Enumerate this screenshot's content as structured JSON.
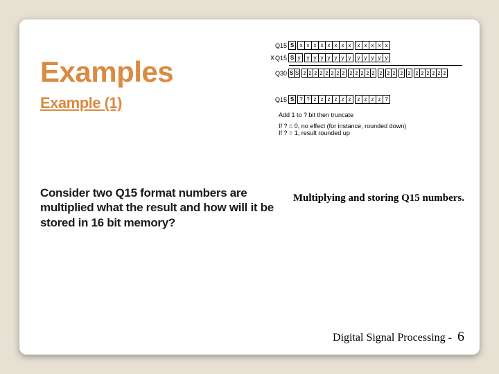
{
  "title": "Examples",
  "subtitle": "Example (1)",
  "body": "Consider two Q15 format numbers are multiplied what the result and how will it be stored in 16 bit memory?",
  "caption": "Multiplying and storing Q15 numbers.",
  "footer_text": "Digital Signal Processing - ",
  "page_number": "6",
  "diagram": {
    "r1": {
      "label": "Q15",
      "sign": "S",
      "bits": [
        ".",
        "x",
        "x",
        "x",
        "x",
        "x",
        "x",
        "x",
        "x",
        ".",
        "x",
        "x",
        "x",
        "x",
        "x"
      ]
    },
    "mult": "x",
    "r2": {
      "label": "Q15",
      "sign": "S",
      "bits": [
        "y",
        ".",
        "y",
        "y",
        "y",
        "y",
        "y",
        "y",
        "y",
        ".",
        "y",
        "y",
        "y",
        "y",
        "y"
      ]
    },
    "r3": {
      "label": "Q30",
      "sign": "S",
      "bits": [
        "S",
        ".",
        "z",
        "z",
        "z",
        "z",
        "z",
        "z",
        "z",
        "z",
        ".",
        "z",
        "z",
        "z",
        "z",
        "z",
        ".",
        "z",
        ".",
        "z",
        "z",
        ".",
        "z",
        ".",
        "z",
        ".",
        "z",
        "z",
        "z",
        "z",
        "z",
        "z"
      ]
    },
    "r4": {
      "label": "Q15",
      "sign": "S",
      "bits": [
        ".",
        "?",
        "?",
        "z",
        "z",
        "z",
        "z",
        "z",
        "z",
        ".",
        "z",
        "z",
        "z",
        "z",
        "?"
      ]
    },
    "note": "Add 1 to ? bit then truncate",
    "c1": "If ? = 0, no effect (for instance, rounded down)",
    "c2": "If ? = 1, result rounded up"
  }
}
